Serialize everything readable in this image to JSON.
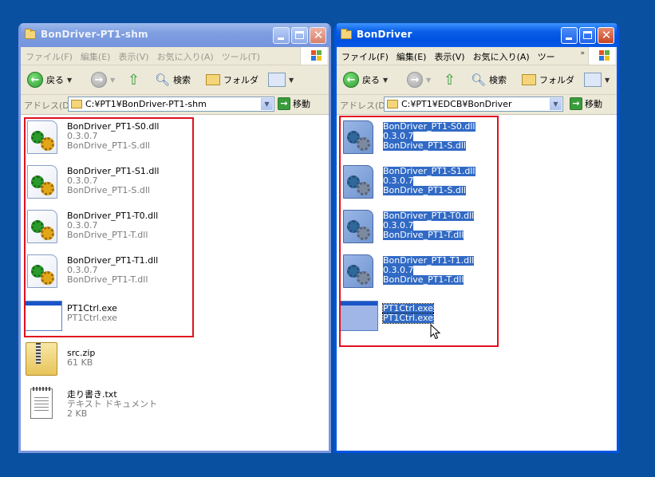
{
  "left_window": {
    "title": "BonDriver-PT1-shm",
    "menu": [
      "ファイル(F)",
      "編集(E)",
      "表示(V)",
      "お気に入り(A)",
      "ツール(T)"
    ],
    "toolbar": {
      "back": "戻る",
      "search": "検索",
      "folders": "フォルダ"
    },
    "address_label": "アドレス(D)",
    "address": "C:¥PT1¥BonDriver-PT1-shm",
    "go": "移動",
    "files": [
      {
        "name": "BonDriver_PT1-S0.dll",
        "line2": "0.3.0.7",
        "line3": "BonDrive_PT1-S.dll",
        "type": "dll"
      },
      {
        "name": "BonDriver_PT1-S1.dll",
        "line2": "0.3.0.7",
        "line3": "BonDrive_PT1-S.dll",
        "type": "dll"
      },
      {
        "name": "BonDriver_PT1-T0.dll",
        "line2": "0.3.0.7",
        "line3": "BonDrive_PT1-T.dll",
        "type": "dll"
      },
      {
        "name": "BonDriver_PT1-T1.dll",
        "line2": "0.3.0.7",
        "line3": "BonDrive_PT1-T.dll",
        "type": "dll"
      },
      {
        "name": "PT1Ctrl.exe",
        "line2": "PT1Ctrl.exe",
        "line3": "",
        "type": "exe"
      },
      {
        "name": "src.zip",
        "line2": "61 KB",
        "line3": "",
        "type": "zip"
      },
      {
        "name": "走り書き.txt",
        "line2": "テキスト ドキュメント",
        "line3": "2 KB",
        "type": "txt"
      }
    ]
  },
  "right_window": {
    "title": "BonDriver",
    "menu": [
      "ファイル(F)",
      "編集(E)",
      "表示(V)",
      "お気に入り(A)",
      "ツー"
    ],
    "toolbar": {
      "back": "戻る",
      "search": "検索",
      "folders": "フォルダ"
    },
    "address_label": "アドレス(D)",
    "address": "C:¥PT1¥EDCB¥BonDriver",
    "go": "移動",
    "files": [
      {
        "name": "BonDriver_PT1-S0.dll",
        "line2": "0.3.0.7",
        "line3": "BonDrive_PT1-S.dll",
        "type": "dll"
      },
      {
        "name": "BonDriver_PT1-S1.dll",
        "line2": "0.3.0.7",
        "line3": "BonDrive_PT1-S.dll",
        "type": "dll"
      },
      {
        "name": "BonDriver_PT1-T0.dll",
        "line2": "0.3.0.7",
        "line3": "BonDrive_PT1-T.dll",
        "type": "dll"
      },
      {
        "name": "BonDriver_PT1-T1.dll",
        "line2": "0.3.0.7",
        "line3": "BonDrive_PT1-T.dll",
        "type": "dll"
      },
      {
        "name": "PT1Ctrl.exe",
        "line2": "PT1Ctrl.exe",
        "line3": "",
        "type": "exe"
      }
    ]
  },
  "colors": {
    "selection": "#316ac5",
    "highlight_box": "#e01020",
    "desktop": "#0a50a0"
  }
}
